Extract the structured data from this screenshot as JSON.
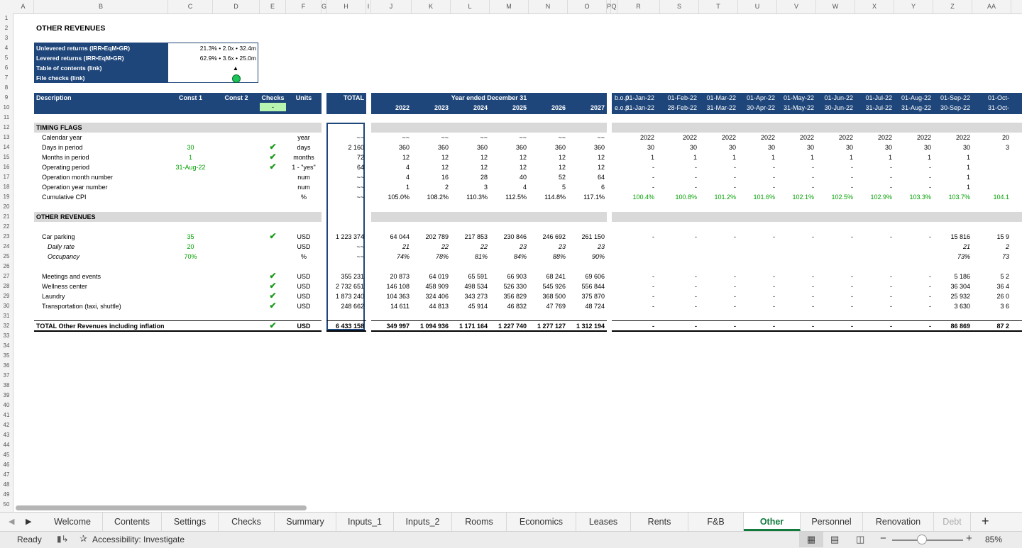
{
  "column_letters": [
    "A",
    "B",
    "C",
    "D",
    "E",
    "F",
    "G",
    "H",
    "I",
    "J",
    "K",
    "L",
    "M",
    "N",
    "O",
    "P",
    "Q",
    "R",
    "S",
    "T",
    "U",
    "V",
    "W",
    "X",
    "Y",
    "Z",
    "AA"
  ],
  "row_numbers": [
    "1",
    "2",
    "3",
    "4",
    "5",
    "6",
    "7",
    "8",
    "9",
    "10",
    "11",
    "12",
    "13",
    "14",
    "15",
    "16",
    "17",
    "18",
    "19",
    "20",
    "21",
    "22",
    "23",
    "24",
    "25",
    "26",
    "27",
    "28",
    "29",
    "30",
    "31",
    "32",
    "33",
    "34",
    "35",
    "36",
    "37",
    "38",
    "39",
    "40",
    "41",
    "42",
    "43",
    "44",
    "45",
    "46",
    "47",
    "48",
    "49",
    "50"
  ],
  "sheet_title": "OTHER REVENUES",
  "summary_box": [
    {
      "label": "Unlevered returns (IRR•EqM•GR)",
      "value": "21.3% • 2.0x • 32.4m"
    },
    {
      "label": "Levered returns (IRR•EqM•GR)",
      "value": "62.9% • 3.6x • 25.0m"
    },
    {
      "label": "Table of contents (link)",
      "value": "▲"
    },
    {
      "label": "File checks (link)",
      "value": ""
    }
  ],
  "header": {
    "description": "Description",
    "const1": "Const 1",
    "const2": "Const 2",
    "checks": "Checks",
    "checks_value": "-",
    "units": "Units",
    "total": "TOTAL",
    "year_banner": "Year ended December 31",
    "years": [
      "2022",
      "2023",
      "2024",
      "2025",
      "2026",
      "2027"
    ],
    "bop": "b.o.p.",
    "eop": "e.o.p.",
    "month_starts": [
      "01-Jan-22",
      "01-Feb-22",
      "01-Mar-22",
      "01-Apr-22",
      "01-May-22",
      "01-Jun-22",
      "01-Jul-22",
      "01-Aug-22",
      "01-Sep-22",
      "01-Oct-"
    ],
    "month_ends": [
      "31-Jan-22",
      "28-Feb-22",
      "31-Mar-22",
      "30-Apr-22",
      "31-May-22",
      "30-Jun-22",
      "31-Jul-22",
      "31-Aug-22",
      "30-Sep-22",
      "31-Oct-"
    ]
  },
  "sections": {
    "timing": "TIMING FLAGS",
    "other": "OTHER REVENUES"
  },
  "rows": [
    {
      "r": 13,
      "label": "Calendar year",
      "c1": "",
      "check": false,
      "units": "year",
      "total": "~~",
      "years": [
        "~~",
        "~~",
        "~~",
        "~~",
        "~~",
        "~~"
      ],
      "months": [
        "2022",
        "2022",
        "2022",
        "2022",
        "2022",
        "2022",
        "2022",
        "2022",
        "2022",
        "20"
      ]
    },
    {
      "r": 14,
      "label": "Days in period",
      "c1": "30",
      "check": true,
      "units": "days",
      "total": "2 160",
      "years": [
        "360",
        "360",
        "360",
        "360",
        "360",
        "360"
      ],
      "months": [
        "30",
        "30",
        "30",
        "30",
        "30",
        "30",
        "30",
        "30",
        "30",
        "3"
      ]
    },
    {
      "r": 15,
      "label": "Months in period",
      "c1": "1",
      "check": true,
      "units": "months",
      "total": "72",
      "years": [
        "12",
        "12",
        "12",
        "12",
        "12",
        "12"
      ],
      "months": [
        "1",
        "1",
        "1",
        "1",
        "1",
        "1",
        "1",
        "1",
        "1",
        ""
      ]
    },
    {
      "r": 16,
      "label": "Operating period",
      "c1": "31-Aug-22",
      "check": true,
      "units": "1 - \"yes\"",
      "total": "64",
      "years": [
        "4",
        "12",
        "12",
        "12",
        "12",
        "12"
      ],
      "months": [
        "-",
        "-",
        "-",
        "-",
        "-",
        "-",
        "-",
        "-",
        "1",
        ""
      ]
    },
    {
      "r": 17,
      "label": "Operation month number",
      "c1": "",
      "check": false,
      "units": "num",
      "total": "~~",
      "years": [
        "4",
        "16",
        "28",
        "40",
        "52",
        "64"
      ],
      "months": [
        "-",
        "-",
        "-",
        "-",
        "-",
        "-",
        "-",
        "-",
        "1",
        ""
      ]
    },
    {
      "r": 18,
      "label": "Operation year number",
      "c1": "",
      "check": false,
      "units": "num",
      "total": "~~",
      "years": [
        "1",
        "2",
        "3",
        "4",
        "5",
        "6"
      ],
      "months": [
        "-",
        "-",
        "-",
        "-",
        "-",
        "-",
        "-",
        "-",
        "1",
        ""
      ]
    },
    {
      "r": 19,
      "label": "Cumulative CPI",
      "c1": "",
      "check": false,
      "units": "%",
      "total": "~~",
      "years": [
        "105.0%",
        "108.2%",
        "110.3%",
        "112.5%",
        "114.8%",
        "117.1%"
      ],
      "months": [
        "100.4%",
        "100.8%",
        "101.2%",
        "101.6%",
        "102.1%",
        "102.5%",
        "102.9%",
        "103.3%",
        "103.7%",
        "104.1"
      ],
      "green_months": true
    },
    {
      "r": 23,
      "label": "Car parking",
      "c1": "35",
      "check": true,
      "units": "USD",
      "total": "1 223 374",
      "years": [
        "64 044",
        "202 789",
        "217 853",
        "230 846",
        "246 692",
        "261 150"
      ],
      "months": [
        "-",
        "-",
        "-",
        "-",
        "-",
        "-",
        "-",
        "-",
        "15 816",
        "15 9"
      ]
    },
    {
      "r": 24,
      "label": "Daily rate",
      "c1": "20",
      "check": false,
      "units": "USD",
      "total": "~~",
      "years": [
        "21",
        "22",
        "22",
        "23",
        "23",
        "23"
      ],
      "months": [
        "",
        "",
        "",
        "",
        "",
        "",
        "",
        "",
        "21",
        "2"
      ],
      "italic": true
    },
    {
      "r": 25,
      "label": "Occupancy",
      "c1": "70%",
      "check": false,
      "units": "%",
      "total": "~~",
      "years": [
        "74%",
        "78%",
        "81%",
        "84%",
        "88%",
        "90%"
      ],
      "months": [
        "",
        "",
        "",
        "",
        "",
        "",
        "",
        "",
        "73%",
        "73"
      ],
      "italic": true
    },
    {
      "r": 27,
      "label": "Meetings and events",
      "c1": "",
      "check": true,
      "units": "USD",
      "total": "355 231",
      "years": [
        "20 873",
        "64 019",
        "65 591",
        "66 903",
        "68 241",
        "69 606"
      ],
      "months": [
        "-",
        "-",
        "-",
        "-",
        "-",
        "-",
        "-",
        "-",
        "5 186",
        "5 2"
      ]
    },
    {
      "r": 28,
      "label": "Wellness center",
      "c1": "",
      "check": true,
      "units": "USD",
      "total": "2 732 651",
      "years": [
        "146 108",
        "458 909",
        "498 534",
        "526 330",
        "545 926",
        "556 844"
      ],
      "months": [
        "-",
        "-",
        "-",
        "-",
        "-",
        "-",
        "-",
        "-",
        "36 304",
        "36 4"
      ]
    },
    {
      "r": 29,
      "label": "Laundry",
      "c1": "",
      "check": true,
      "units": "USD",
      "total": "1 873 240",
      "years": [
        "104 363",
        "324 406",
        "343 273",
        "356 829",
        "368 500",
        "375 870"
      ],
      "months": [
        "-",
        "-",
        "-",
        "-",
        "-",
        "-",
        "-",
        "-",
        "25 932",
        "26 0"
      ]
    },
    {
      "r": 30,
      "label": "Transportation (taxi, shuttle)",
      "c1": "",
      "check": true,
      "units": "USD",
      "total": "248 662",
      "years": [
        "14 611",
        "44 813",
        "45 914",
        "46 832",
        "47 769",
        "48 724"
      ],
      "months": [
        "-",
        "-",
        "-",
        "-",
        "-",
        "-",
        "-",
        "-",
        "3 630",
        "3 6"
      ]
    },
    {
      "r": 32,
      "label": "TOTAL Other Revenues including inflation",
      "c1": "",
      "check": true,
      "units": "USD",
      "total": "6 433 158",
      "years": [
        "349 997",
        "1 094 936",
        "1 171 164",
        "1 227 740",
        "1 277 127",
        "1 312 194"
      ],
      "months": [
        "-",
        "-",
        "-",
        "-",
        "-",
        "-",
        "-",
        "-",
        "86 869",
        "87 2"
      ],
      "bold": true
    }
  ],
  "tabs": [
    "Welcome",
    "Contents",
    "Settings",
    "Checks",
    "Summary",
    "Inputs_1",
    "Inputs_2",
    "Rooms",
    "Economics",
    "Leases",
    "Rents",
    "F&B",
    "Other",
    "Personnel",
    "Renovation",
    "Debt"
  ],
  "active_tab": "Other",
  "status": {
    "ready": "Ready",
    "accessibility": "Accessibility: Investigate",
    "zoom": "85%"
  },
  "colors": {
    "navy": "#1f467a",
    "green": "#00a000",
    "active_tab": "#127a3c"
  }
}
